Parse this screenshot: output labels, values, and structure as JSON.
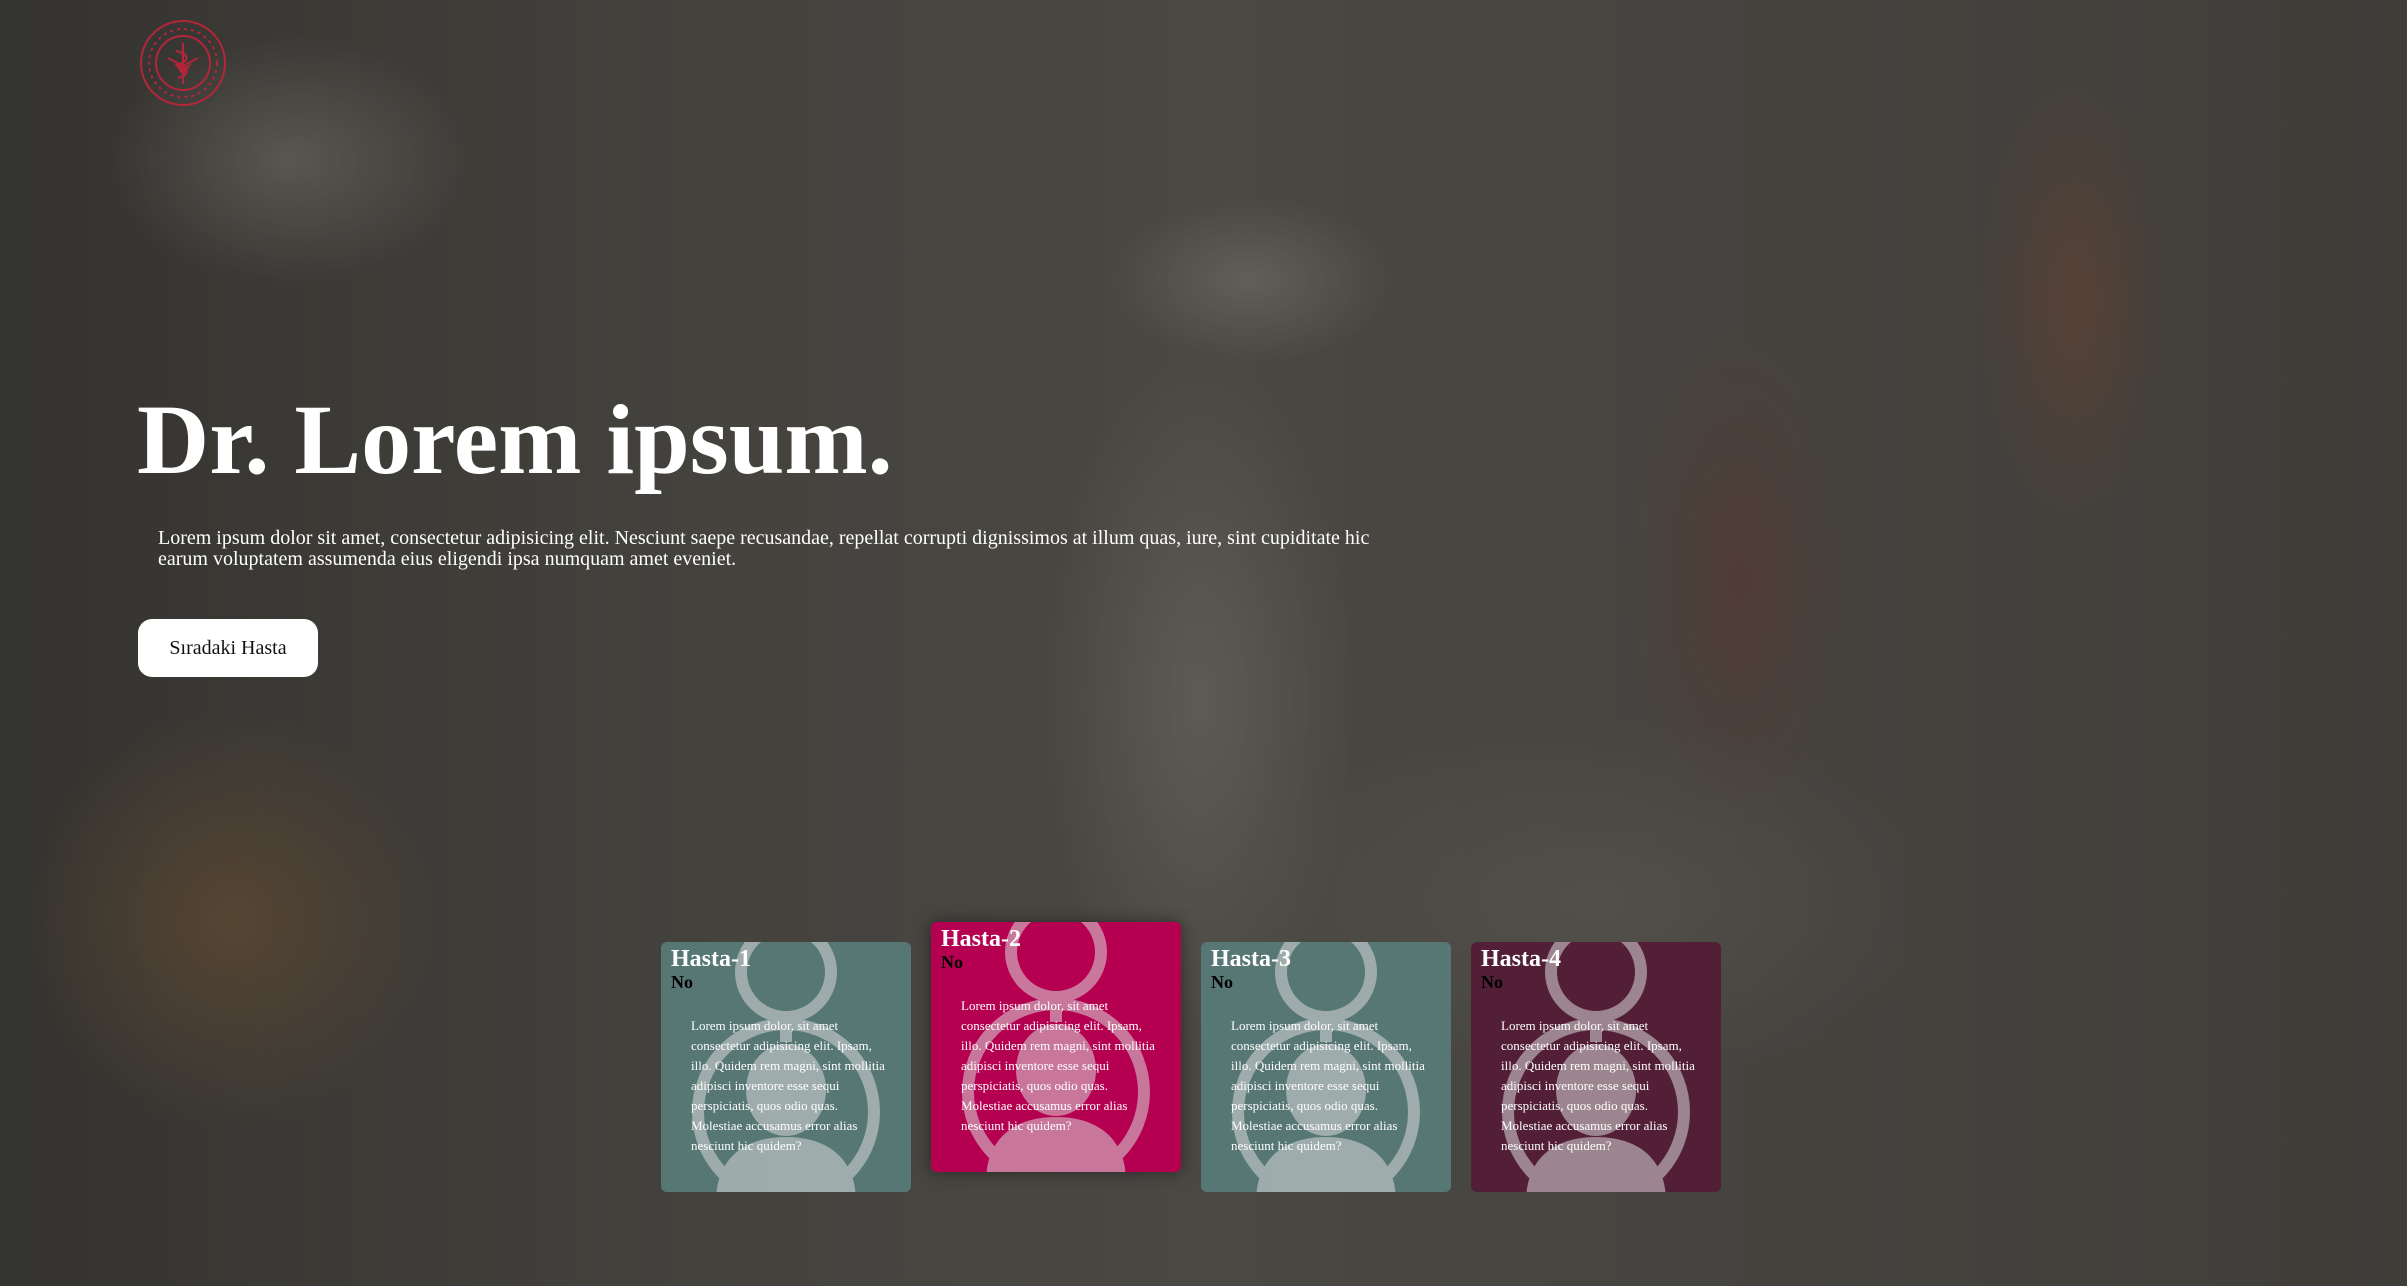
{
  "colors": {
    "title": "#ffffff",
    "button_bg": "#ffffff",
    "logo_red": "#b3263a"
  },
  "header": {
    "logo_icon": "ministry-emblem-icon"
  },
  "hero": {
    "title": "Dr. Lorem ipsum.",
    "description": "Lorem ipsum dolor sit amet, consectetur adipisicing elit. Nesciunt saepe recusandae, repellat corrupti dignissimos at illum quas, iure, sint cupiditate hic earum voluptatem assumenda eius eligendi ipsa numquam amet eveniet.",
    "next_button": "Sıradaki Hasta"
  },
  "patients": [
    {
      "title": "Hasta-1",
      "no": "No",
      "text": "Lorem ipsum dolor, sit amet consectetur adipisicing elit. Ipsam, illo. Quidem rem magni, sint mollitia adipisci inventore esse sequi perspiciatis, quos odio quas. Molestiae accusamus error alias nesciunt hic quidem?",
      "color": "#567773",
      "icon": "female-patient-icon",
      "active": false
    },
    {
      "title": "Hasta-2",
      "no": "No",
      "text": "Lorem ipsum dolor, sit amet consectetur adipisicing elit. Ipsam, illo. Quidem rem magni, sint mollitia adipisci inventore esse sequi perspiciatis, quos odio quas. Molestiae accusamus error alias nesciunt hic quidem?",
      "color": "#b50051",
      "icon": "female-patient-icon",
      "active": true
    },
    {
      "title": "Hasta-3",
      "no": "No",
      "text": "Lorem ipsum dolor, sit amet consectetur adipisicing elit. Ipsam, illo. Quidem rem magni, sint mollitia adipisci inventore esse sequi perspiciatis, quos odio quas. Molestiae accusamus error alias nesciunt hic quidem?",
      "color": "#567773",
      "icon": "female-patient-icon",
      "active": false
    },
    {
      "title": "Hasta-4",
      "no": "No",
      "text": "Lorem ipsum dolor, sit amet consectetur adipisicing elit. Ipsam, illo. Quidem rem magni, sint mollitia adipisci inventore esse sequi perspiciatis, quos odio quas. Molestiae accusamus error alias nesciunt hic quidem?",
      "color": "#521f36",
      "icon": "female-patient-icon",
      "active": false
    }
  ]
}
